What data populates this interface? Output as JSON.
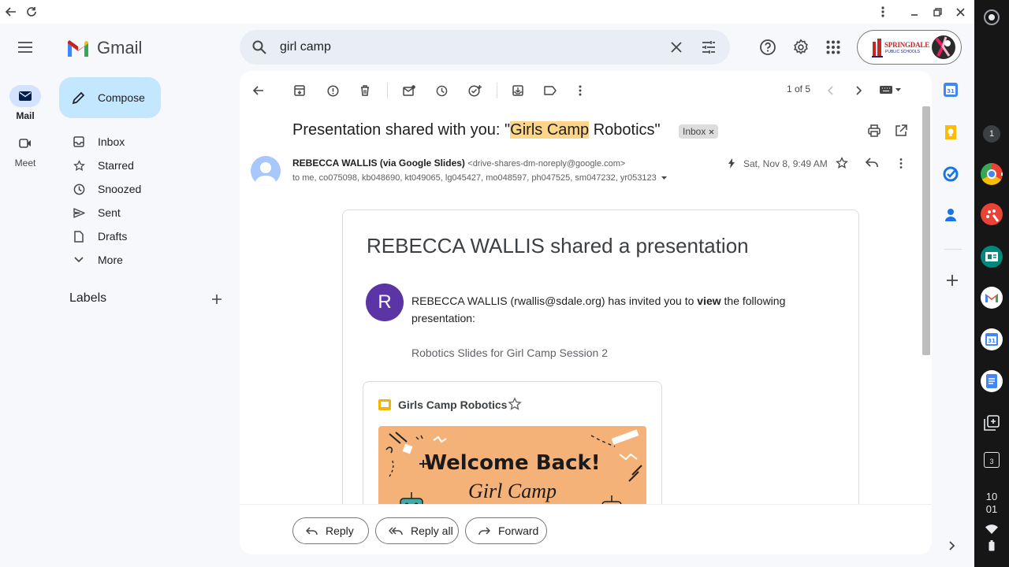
{
  "app": {
    "name": "Gmail",
    "brand_color": "#ea4335"
  },
  "rail": {
    "mail_label": "Mail",
    "meet_label": "Meet"
  },
  "compose_label": "Compose",
  "sidebar": {
    "items": [
      {
        "label": "Inbox",
        "icon": "inbox-icon"
      },
      {
        "label": "Starred",
        "icon": "star-icon"
      },
      {
        "label": "Snoozed",
        "icon": "clock-icon"
      },
      {
        "label": "Sent",
        "icon": "send-icon"
      },
      {
        "label": "Drafts",
        "icon": "draft-icon"
      },
      {
        "label": "More",
        "icon": "chevron-down-icon"
      }
    ],
    "labels_heading": "Labels"
  },
  "search": {
    "value": "girl camp"
  },
  "account": {
    "org_name": "SPRINGDALE",
    "org_sub": "PUBLIC SCHOOLS"
  },
  "toolbar": {
    "pagination": "1 of 5"
  },
  "email": {
    "subject_prefix": "Presentation shared with you: \"",
    "subject_highlight": "Girls Camp",
    "subject_suffix": " Robotics\"",
    "label_badge": "Inbox",
    "sender_name": "REBECCA WALLIS (via Google Slides)",
    "sender_email": "<drive-shares-dm-noreply@google.com>",
    "date": "Sat, Nov 8, 9:49 AM",
    "recipients": "to me, co075098, kb048690, kt049065, lg045427, mo048597, ph047525, sm047232, yr053123",
    "card_title": "REBECCA WALLIS shared a presentation",
    "avatar_letter": "R",
    "invite_text_start": "REBECCA WALLIS (rwallis@sdale.org) has invited you to ",
    "invite_text_bold": "view",
    "invite_text_end": " the following presentation:",
    "message": "Robotics Slides for Girl Camp Session 2",
    "file_name": "Girls Camp Robotics",
    "thumb_title": "Welcome Back!",
    "thumb_subtitle": "Girl Camp"
  },
  "actions": {
    "reply": "Reply",
    "reply_all": "Reply all",
    "forward": "Forward"
  },
  "shelf": {
    "notification_count": "1",
    "time_hour": "10",
    "time_min": "01",
    "desk_num": "3"
  },
  "colors": {
    "accent": "#0b57d0",
    "compose_bg": "#c2e7ff",
    "highlight": "#fcd588",
    "avatar": "#5b35a5",
    "thumb_bg": "#f5b278"
  }
}
